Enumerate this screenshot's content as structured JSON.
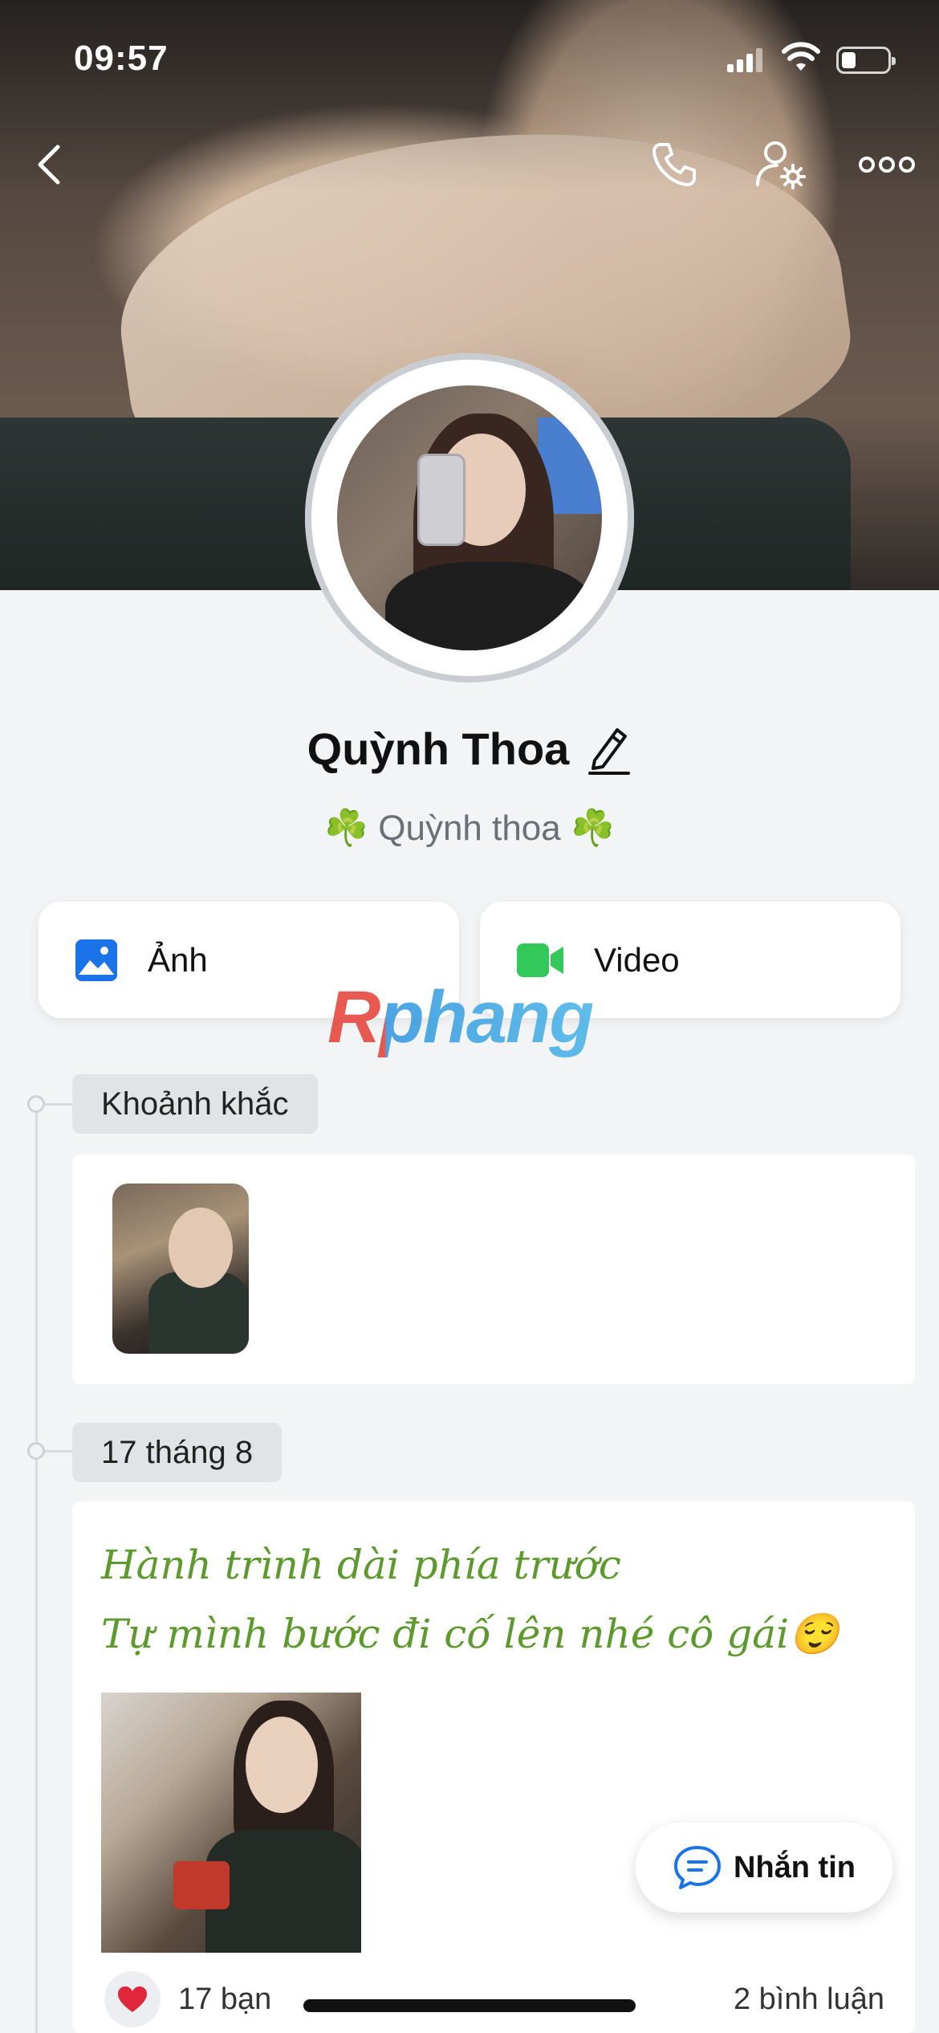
{
  "status_bar": {
    "time": "09:57",
    "battery_level": 0.3
  },
  "profile": {
    "name": "Quỳnh Thoa",
    "subtitle": "☘️ Quỳnh thoa ☘️"
  },
  "media_tabs": [
    {
      "label": "Ảnh",
      "icon": "photo-icon"
    },
    {
      "label": "Video",
      "icon": "video-icon"
    }
  ],
  "watermark": "Rphang",
  "timeline": {
    "moments_label": "Khoảnh khắc",
    "date_label": "17 tháng 8"
  },
  "post": {
    "line1": "Hành trình dài phía trước",
    "line2": "Tự mình bước đi cố lên nhé cô gái😌",
    "likes": "17 bạn",
    "comments": "2 bình luận"
  },
  "chat_button": {
    "label": "Nhắn tin"
  },
  "colors": {
    "accent": "#1a73e8",
    "green": "#5d9a2d",
    "video": "#34c759"
  }
}
